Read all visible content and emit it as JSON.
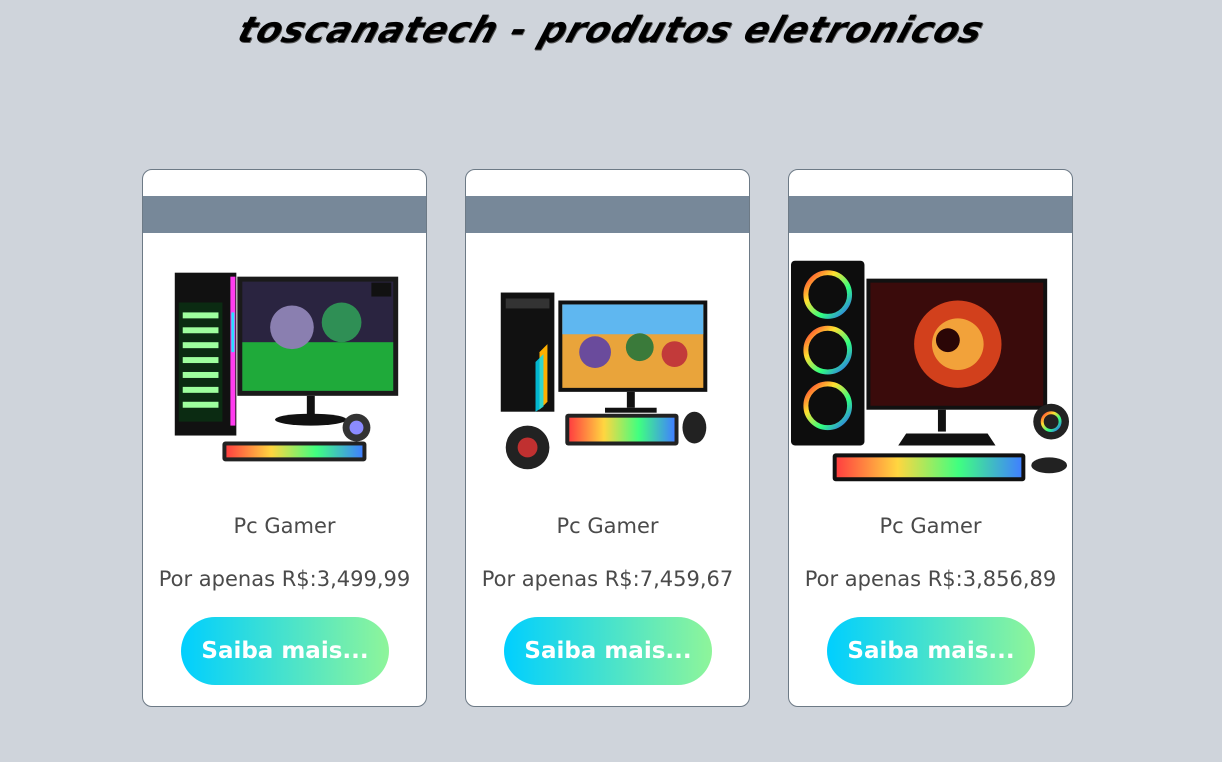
{
  "header": {
    "title": "toscanatech - produtos eletronicos"
  },
  "products": [
    {
      "name": "Pc Gamer",
      "price": "Por apenas R$:3,499,99",
      "button_label": "Saiba mais...",
      "image": "gaming-pc-setup-20in"
    },
    {
      "name": "Pc Gamer",
      "price": "Por apenas R$:7,459,67",
      "button_label": "Saiba mais...",
      "image": "gaming-pc-setup-fortnite"
    },
    {
      "name": "Pc Gamer",
      "price": "Por apenas R$:3,856,89",
      "button_label": "Saiba mais...",
      "image": "gaming-pc-setup-19-5in"
    }
  ],
  "colors": {
    "background": "#cfd4db",
    "card_band": "#778899",
    "button_gradient_start": "#00cfff",
    "button_gradient_end": "#8ef59a"
  }
}
